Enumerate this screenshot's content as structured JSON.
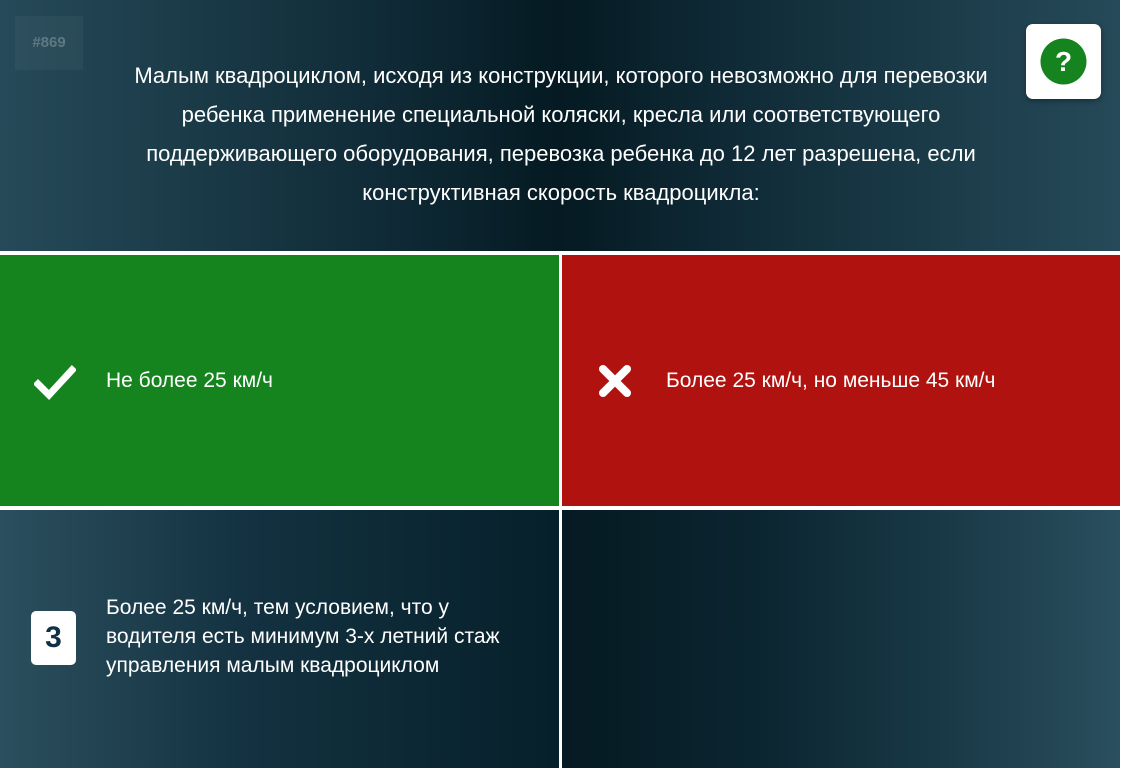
{
  "question": {
    "number": "#869",
    "text": "Малым квадроциклом, исходя из конструкции, которого невозможно для перевозки\nребенка применение специальной коляски, кресла или соответствующего\nподдерживающего оборудования, перевозка ребенка до 12 лет разрешена, если\nконструктивная скорость квадроцикла:"
  },
  "help_button": {
    "icon": "question-circle-icon",
    "label": "?",
    "color": "#15841f"
  },
  "answers": [
    {
      "text": "Не более 25 км/ч",
      "state": "correct",
      "icon": "checkmark-icon",
      "color": "#15841f"
    },
    {
      "text": "Более 25 км/ч, но меньше 45 км/ч",
      "state": "wrong",
      "icon": "cross-icon",
      "color": "#b0120f"
    },
    {
      "number": "3",
      "text": "Более 25 км/ч, тем условием, что у\nводителя есть минимум 3-х летний стаж\nуправления малым квадроциклом",
      "state": "unselected"
    },
    {
      "text": "",
      "state": "empty"
    }
  ]
}
